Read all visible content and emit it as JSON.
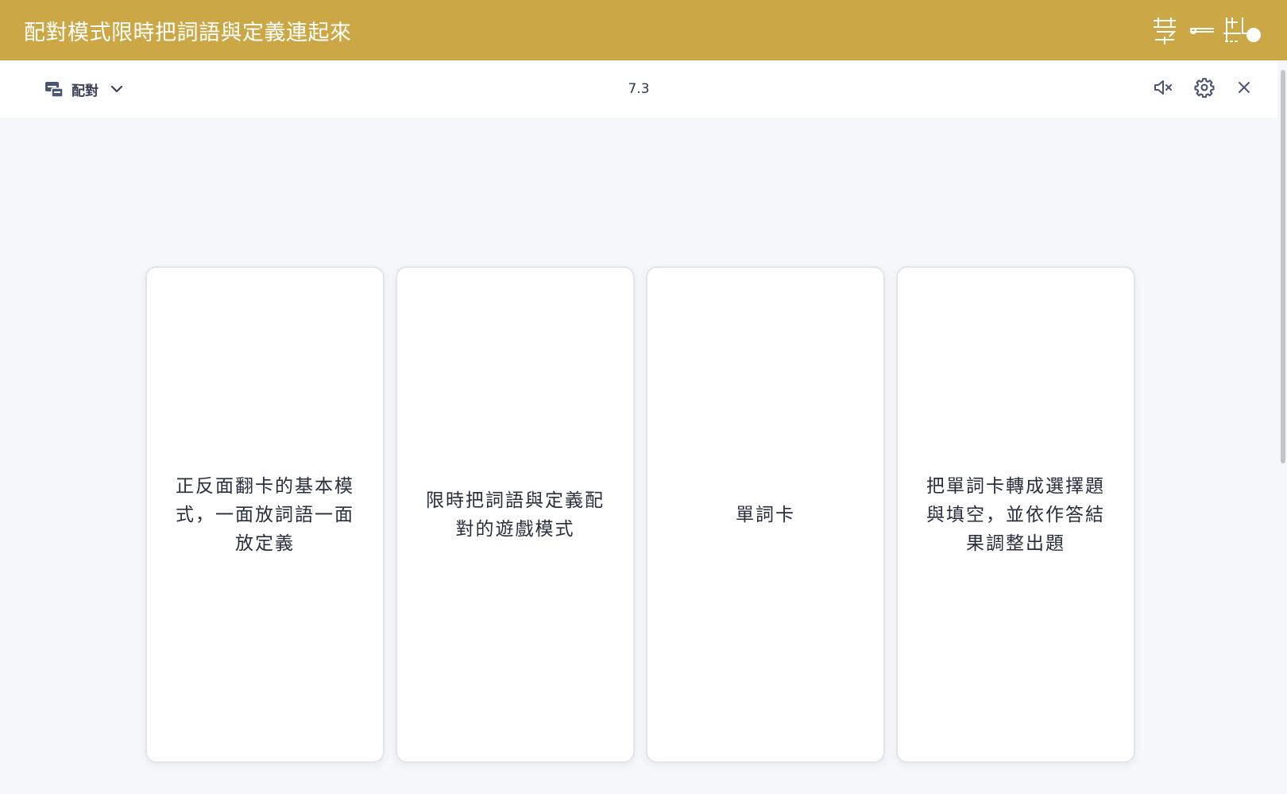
{
  "banner": {
    "title": "配對模式限時把詞語與定義連起來",
    "logo": "學習點"
  },
  "toolbar": {
    "mode_label": "配對",
    "mode_icon": "match-mode-icon",
    "progress": "7.3",
    "buttons": [
      "mute-icon",
      "gear-icon",
      "close-icon"
    ]
  },
  "cards": [
    {
      "text": "正反面翻卡的基本模式，一面放詞語一面放定義"
    },
    {
      "text": "限時把詞語與定義配對的遊戲模式"
    },
    {
      "text": "單詞卡"
    },
    {
      "text": "把單詞卡轉成選擇題與填空，並依作答結果調整出題"
    }
  ],
  "colors": {
    "banner": "#cba745",
    "background": "#f6f7fb",
    "card": "#ffffff",
    "icon": "#4a5677",
    "text": "#282e3e"
  }
}
